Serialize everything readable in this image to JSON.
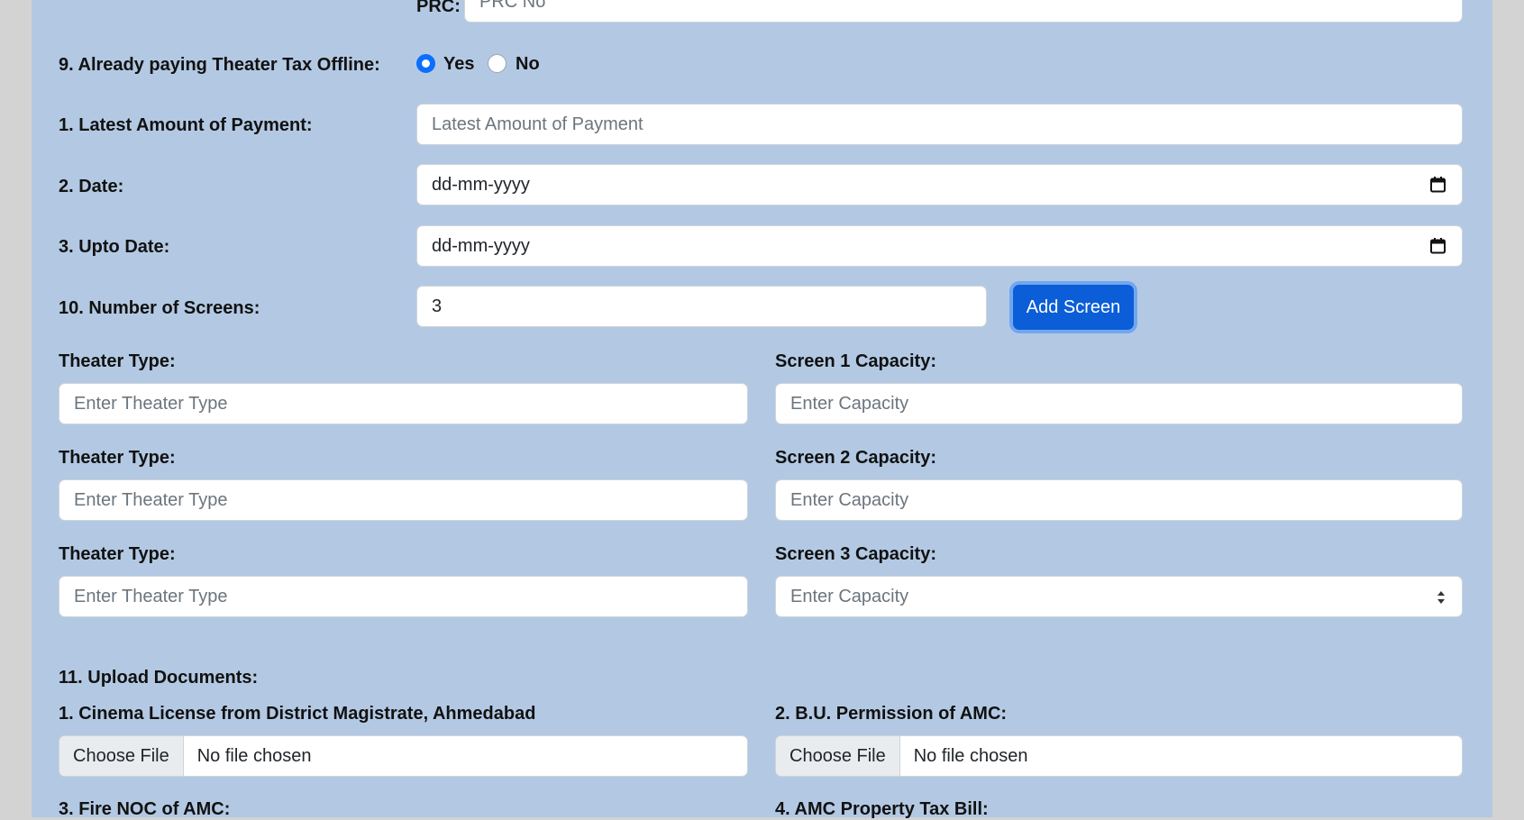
{
  "prc": {
    "label": "PRC:",
    "placeholder": "PRC No"
  },
  "theater_tax": {
    "label": "9. Already paying Theater Tax Offline:",
    "options": [
      {
        "label": "Yes",
        "selected": true
      },
      {
        "label": "No",
        "selected": false
      }
    ]
  },
  "payment": {
    "label": "1. Latest Amount of Payment:",
    "placeholder": "Latest Amount of Payment"
  },
  "date": {
    "label": "2. Date:",
    "value": "dd-mm-yyyy"
  },
  "upto_date": {
    "label": "3. Upto Date:",
    "value": "dd-mm-yyyy"
  },
  "screens": {
    "label": "10. Number of Screens:",
    "value": "3",
    "add_button": "Add Screen"
  },
  "screen_rows": [
    {
      "theater_label": "Theater Type:",
      "theater_placeholder": "Enter Theater Type",
      "capacity_label": "Screen 1 Capacity:",
      "capacity_placeholder": "Enter Capacity"
    },
    {
      "theater_label": "Theater Type:",
      "theater_placeholder": "Enter Theater Type",
      "capacity_label": "Screen 2 Capacity:",
      "capacity_placeholder": "Enter Capacity"
    },
    {
      "theater_label": "Theater Type:",
      "theater_placeholder": "Enter Theater Type",
      "capacity_label": "Screen 3 Capacity:",
      "capacity_placeholder": "Enter Capacity"
    }
  ],
  "uploads": {
    "heading": "11. Upload Documents:",
    "items": [
      {
        "label": "1. Cinema License from District Magistrate, Ahmedabad",
        "button": "Choose File",
        "status": "No file chosen"
      },
      {
        "label": "2. B.U. Permission of AMC:",
        "button": "Choose File",
        "status": "No file chosen"
      },
      {
        "label": "3. Fire NOC of AMC:"
      },
      {
        "label": "4. AMC Property Tax Bill:"
      }
    ]
  },
  "colors": {
    "panel_bg": "#b3c9e3",
    "page_bg": "#d3d3d3",
    "accent": "#0b5ed7"
  },
  "icons": {
    "date": "calendar-icon",
    "stepper": "spinner-arrows-icon"
  }
}
